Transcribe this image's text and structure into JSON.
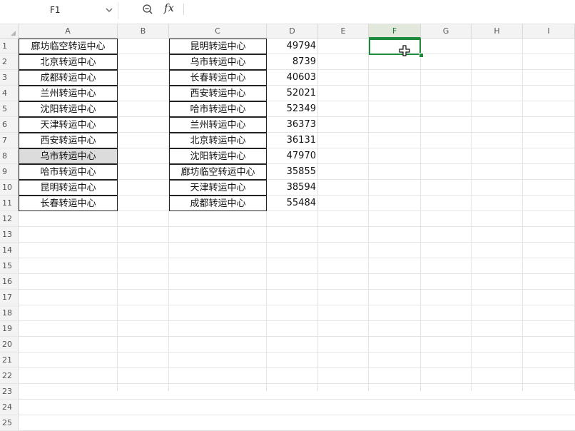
{
  "formula_bar": {
    "name_box": "F1",
    "formula": ""
  },
  "columns": [
    "A",
    "B",
    "C",
    "D",
    "E",
    "F",
    "G",
    "H",
    "I"
  ],
  "rows": [
    "1",
    "2",
    "3",
    "4",
    "5",
    "6",
    "7",
    "8",
    "9",
    "10",
    "11",
    "12",
    "13",
    "14",
    "15",
    "16",
    "17",
    "18",
    "19",
    "20",
    "21",
    "22",
    "23",
    "24",
    "25"
  ],
  "column_a": [
    "廊坊临空转运中心",
    "北京转运中心",
    "成都转运中心",
    "兰州转运中心",
    "沈阳转运中心",
    "天津转运中心",
    "西安转运中心",
    "乌市转运中心",
    "哈市转运中心",
    "昆明转运中心",
    "长春转运中心"
  ],
  "column_c": [
    "昆明转运中心",
    "乌市转运中心",
    "长春转运中心",
    "西安转运中心",
    "哈市转运中心",
    "兰州转运中心",
    "北京转运中心",
    "沈阳转运中心",
    "廊坊临空转运中心",
    "天津转运中心",
    "成都转运中心"
  ],
  "column_d": [
    "49794",
    "8739",
    "40603",
    "52021",
    "52349",
    "36373",
    "36131",
    "47970",
    "35855",
    "38594",
    "55484"
  ],
  "icons": {
    "name_box_arrow": "chevron-down-icon",
    "zoom": "zoom-out-icon",
    "fx": "fx-icon",
    "cursor": "cell-cursor-icon"
  },
  "colors": {
    "selection": "#1e8a3c",
    "highlight": "#dcdcdc"
  }
}
